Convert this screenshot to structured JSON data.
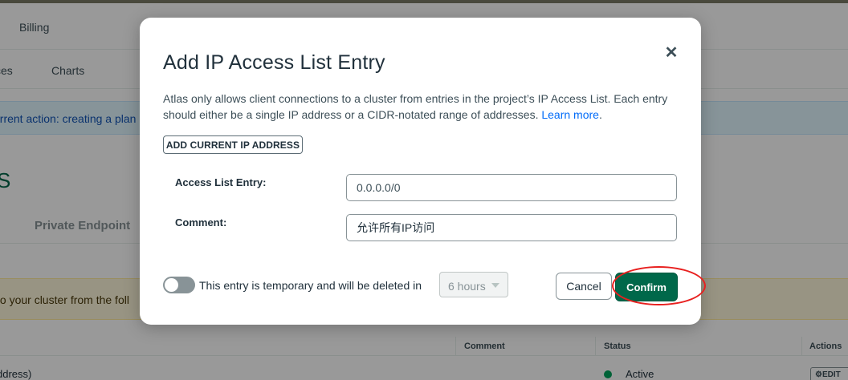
{
  "background": {
    "nav": {
      "billing": "Billing"
    },
    "tabs": [
      "ces",
      "Charts"
    ],
    "banner_text": "urrent action: creating a plan",
    "section_fragment": "S",
    "private_endpoint_tab": "Private Endpoint",
    "notice_text": "to your cluster from the foll",
    "table": {
      "headers": {
        "comment": "Comment",
        "status": "Status",
        "actions": "Actions"
      },
      "row": {
        "ip": "ddress)",
        "status": "Active",
        "edit": "EDIT"
      }
    }
  },
  "modal": {
    "title": "Add IP Access List Entry",
    "description": "Atlas only allows client connections to a cluster from entries in the project’s IP Access List. Each entry should either be a single IP address or a CIDR-notated range of addresses.",
    "learn_more": "Learn more",
    "add_current_ip_label": "ADD CURRENT IP ADDRESS",
    "access_list_entry_label": "Access List Entry:",
    "access_list_entry_value": "0.0.0.0/0",
    "comment_label": "Comment:",
    "comment_value": "允许所有IP访问",
    "temporary_text": "This entry is temporary and will be deleted in",
    "duration_value": "6 hours",
    "cancel_label": "Cancel",
    "confirm_label": "Confirm",
    "close_icon": "close-icon",
    "temporary_toggle": "off"
  },
  "colors": {
    "accent_green": "#00684a",
    "link_blue": "#016bf8",
    "annotation_red": "#e8201f"
  }
}
